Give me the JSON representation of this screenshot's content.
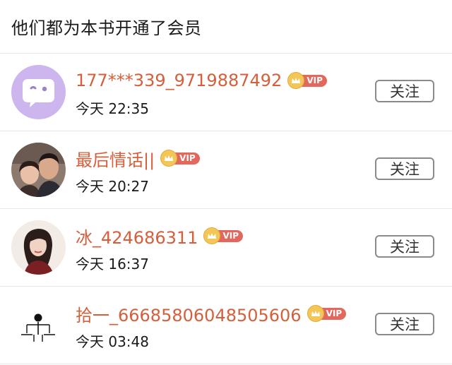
{
  "header": {
    "title": "他们都为本书开通了会员"
  },
  "vip_badge_text": "VIP",
  "follow_label": "关注",
  "colors": {
    "username": "#d65f3b",
    "vip_badge": "#e2685d",
    "vip_crown": "#f3c658",
    "divider": "#e8e8e8"
  },
  "members": [
    {
      "name": "177***339_9719887492",
      "time": "今天 22:35",
      "avatar": "chat-bubble-default-avatar"
    },
    {
      "name": "最后情话||",
      "time": "今天 20:27",
      "avatar": "couple-photo-avatar"
    },
    {
      "name": "冰_424686311",
      "time": "今天 16:37",
      "avatar": "woman-portrait-avatar"
    },
    {
      "name": "拾一_66685806048505606",
      "time": "今天 03:48",
      "avatar": "stick-figure-avatar"
    }
  ]
}
